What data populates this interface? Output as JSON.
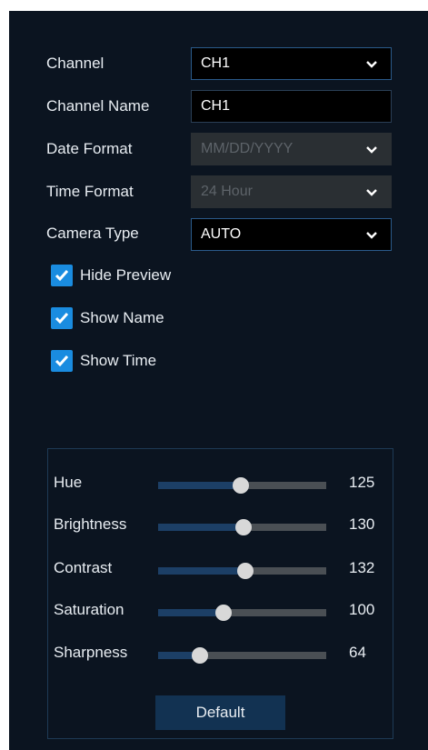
{
  "form": {
    "channel": {
      "label": "Channel",
      "value": "CH1"
    },
    "channel_name": {
      "label": "Channel Name",
      "value": "CH1"
    },
    "date_format": {
      "label": "Date Format",
      "value": "MM/DD/YYYY"
    },
    "time_format": {
      "label": "Time Format",
      "value": "24 Hour"
    },
    "camera_type": {
      "label": "Camera Type",
      "value": "AUTO"
    }
  },
  "checkboxes": [
    {
      "label": "Hide Preview",
      "checked": true
    },
    {
      "label": "Show Name",
      "checked": true
    },
    {
      "label": "Show Time",
      "checked": true
    }
  ],
  "image_settings": {
    "sliders": [
      {
        "label": "Hue",
        "value": "125",
        "level": 0.49
      },
      {
        "label": "Brightness",
        "value": "130",
        "level": 0.51
      },
      {
        "label": "Contrast",
        "value": "132",
        "level": 0.52
      },
      {
        "label": "Saturation",
        "value": "100",
        "level": 0.39
      },
      {
        "label": "Sharpness",
        "value": "64",
        "level": 0.25
      }
    ],
    "default_label": "Default"
  },
  "colors": {
    "background": "#0b1420",
    "accent": "#1a8ce0",
    "slider_fill": "#1c3f66",
    "button": "#123252"
  }
}
